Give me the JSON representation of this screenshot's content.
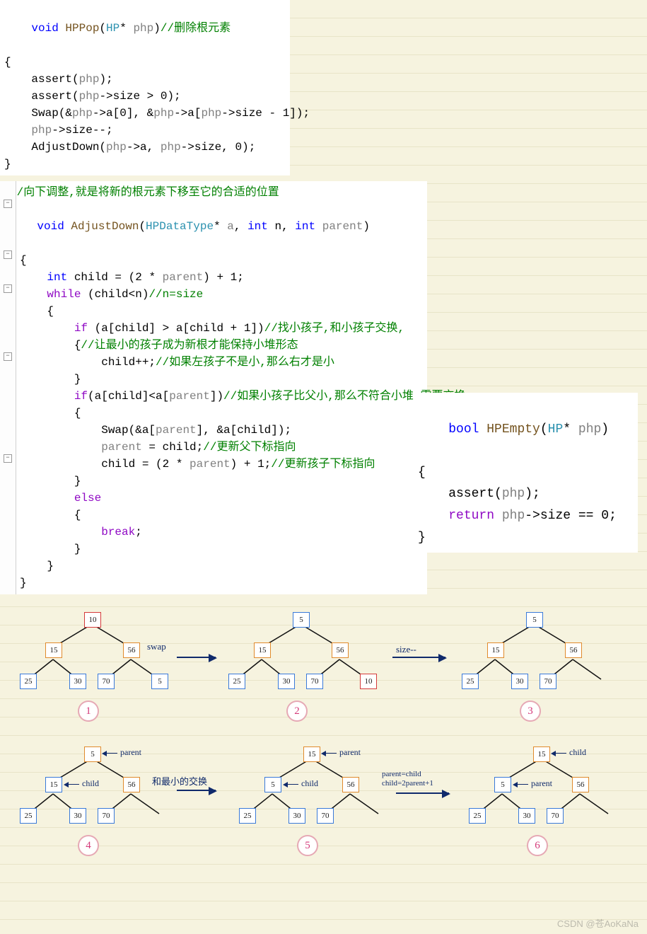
{
  "hp_pop": {
    "sig_void": "void",
    "sig_name": " HPPop",
    "sig_open": "(",
    "sig_type": "HP",
    "sig_star": "* ",
    "sig_param": "php",
    "sig_close": ")",
    "sig_cmt": "//删除根元素",
    "lines": {
      "l1": "{",
      "l2a": "    assert(",
      "l2b": "php",
      "l2c": ");",
      "l3a": "    assert(",
      "l3b": "php",
      "l3c": "->size > 0);",
      "l4a": "    Swap(&",
      "l4b": "php",
      "l4c": "->a[0], &",
      "l4d": "php",
      "l4e": "->a[",
      "l4f": "php",
      "l4g": "->size - 1]);",
      "l5a": "    ",
      "l5b": "php",
      "l5c": "->size--;",
      "l6a": "    AdjustDown(",
      "l6b": "php",
      "l6c": "->a, ",
      "l6d": "php",
      "l6e": "->size, 0);",
      "l7": "}"
    }
  },
  "adjust_down": {
    "top_cmt": "//向下调整,就是将新的根元素下移至它的合适的位置",
    "sig_void": "void",
    "sig_name": " AdjustDown",
    "sig_open": "(",
    "sig_type": "HPDataType",
    "sig_star": "* ",
    "sig_a": "a",
    "sig_c1": ", ",
    "sig_int1": "int",
    "sig_n": " n",
    "sig_c2": ", ",
    "sig_int2": "int",
    "sig_p": " parent",
    "sig_close": ")",
    "body": {
      "open": "{",
      "child_decl_a": "    ",
      "child_decl_int": "int",
      "child_decl_b": " child = (2 * ",
      "child_decl_p": "parent",
      "child_decl_c": ") + 1;",
      "while_a": "    ",
      "while_kw": "while",
      "while_b": " (child<n)",
      "while_cmt": "//n=size",
      "wopen": "    {",
      "if1_a": "        ",
      "if1_kw": "if",
      "if1_b": " (a[child] > a[child + 1])",
      "if1_cmt": "//找小孩子,和小孩子交换,",
      "if1_open_a": "        {",
      "if1_open_cmt": "//让最小的孩子成为新根才能保持小堆形态",
      "childpp_a": "            child++;",
      "childpp_cmt": "//如果左孩子不是小,那么右才是小",
      "if1_close": "        }",
      "if2_a": "        ",
      "if2_kw": "if",
      "if2_b": "(a[child]<a[",
      "if2_p": "parent",
      "if2_c": "])",
      "if2_cmt": "//如果小孩子比父小,那么不符合小堆,需要交换",
      "if2_open": "        {",
      "swap_a": "            Swap(&a[",
      "swap_p": "parent",
      "swap_b": "], &a[child]);",
      "pc_a": "            ",
      "pc_p": "parent",
      "pc_b": " = child;",
      "pc_cmt": "//更新父下标指向",
      "cu_a": "            child = (2 * ",
      "cu_p": "parent",
      "cu_b": ") + 1;",
      "cu_cmt": "//更新孩子下标指向",
      "if2_close": "        }",
      "else_a": "        ",
      "else_kw": "else",
      "else_open": "        {",
      "break_a": "            ",
      "break_kw": "break",
      "break_b": ";",
      "else_close": "        }",
      "wclose": "    }",
      "close": "}"
    }
  },
  "hp_empty": {
    "sig_bool": "bool",
    "sig_name": " HPEmpty",
    "sig_open": "(",
    "sig_type": "HP",
    "sig_star": "* ",
    "sig_param": "php",
    "sig_close": ")",
    "open": "{",
    "assert_a": "    assert(",
    "assert_p": "php",
    "assert_b": ");",
    "ret_a": "    ",
    "ret_kw": "return",
    "ret_b": " ",
    "ret_p": "php",
    "ret_c": "->size == 0;",
    "close": "}"
  },
  "diagram": {
    "step_labels": [
      "1",
      "2",
      "3",
      "4",
      "5",
      "6"
    ],
    "trans_labels": {
      "swap": "swap",
      "sizemm": "size--",
      "cmp": "和最小的交换",
      "parent_child": "parent=child\nchild=2parent+1"
    },
    "ptr_parent": "parent",
    "ptr_child": "child",
    "trees": {
      "t1": {
        "root": "10",
        "l": "15",
        "r": "56",
        "ll": "25",
        "lr": "30",
        "rl": "70",
        "rr": "5"
      },
      "t2": {
        "root": "5",
        "l": "15",
        "r": "56",
        "ll": "25",
        "lr": "30",
        "rl": "70",
        "rr": "10"
      },
      "t3": {
        "root": "5",
        "l": "15",
        "r": "56",
        "ll": "25",
        "lr": "30",
        "rl": "70"
      },
      "t4": {
        "root": "5",
        "l": "15",
        "r": "56",
        "ll": "25",
        "lr": "30",
        "rl": "70"
      },
      "t5": {
        "root": "15",
        "l": "5",
        "r": "56",
        "ll": "25",
        "lr": "30",
        "rl": "70"
      },
      "t6": {
        "root": "15",
        "l": "5",
        "r": "56",
        "ll": "25",
        "lr": "30",
        "rl": "70"
      }
    }
  },
  "watermark": "CSDN @苍AoKaNa"
}
